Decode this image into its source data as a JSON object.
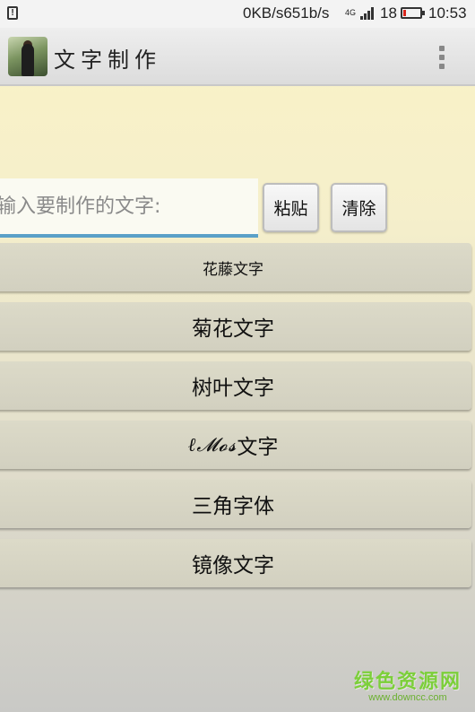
{
  "status_bar": {
    "net_speed": "0KB/s651b/s",
    "net_type": "4G",
    "battery_level": "18",
    "battery_percent": 18,
    "battery_color": "#d9261c",
    "clock": "10:53",
    "warn_glyph": "!"
  },
  "action_bar": {
    "title": "文字制作",
    "icon": "app-icon",
    "menu_icon": "overflow-menu-icon"
  },
  "input": {
    "placeholder": "输入要制作的文字:",
    "value": ""
  },
  "buttons": {
    "paste": "粘贴",
    "clear": "清除"
  },
  "options": [
    {
      "label": "花藤文字"
    },
    {
      "label": "菊花文字"
    },
    {
      "label": "树叶文字"
    },
    {
      "prefix": "ℓ𝓜𝓸𝓼",
      "label": "文字"
    },
    {
      "label": "三角字体"
    },
    {
      "label": "镜像文字"
    }
  ],
  "watermark": {
    "title": "绿色资源网",
    "url": "www.downcc.com"
  }
}
